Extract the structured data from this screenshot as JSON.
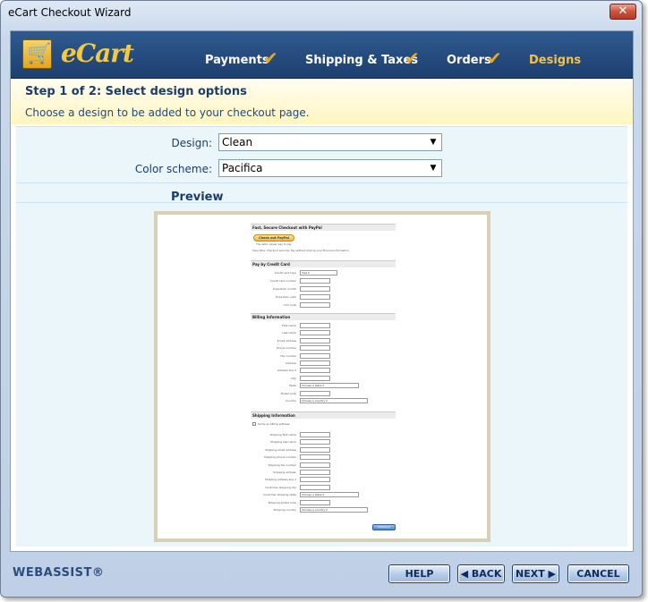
{
  "window": {
    "title": "eCart Checkout Wizard",
    "close_label": "✕"
  },
  "header": {
    "brand": "eCart",
    "steps": [
      {
        "label": "Payments",
        "done": true
      },
      {
        "label": "Shipping & Taxes",
        "done": true
      },
      {
        "label": "Orders",
        "done": true
      },
      {
        "label": "Designs",
        "done": false
      }
    ]
  },
  "step": {
    "title": "Step 1 of 2: Select design options",
    "subtitle": "Choose a design to be added to your checkout page."
  },
  "form": {
    "design_label": "Design:",
    "design_value": "Clean",
    "color_label": "Color scheme:",
    "color_value": "Pacifica"
  },
  "preview": {
    "label": "Preview",
    "sections": {
      "paypal": "Fast, Secure Checkout with PayPal",
      "paypal_btn": "Check out PayPal",
      "paypal_note": "The safer, easier way to pay",
      "paypal_desc": "Save time. Checkout securely. Pay without sharing your financial information.",
      "card": "Pay by Credit Card",
      "card_fields": [
        "Credit card type",
        "Credit card number",
        "Expiration month",
        "Expiration year",
        "CVV code"
      ],
      "card_type_value": "Visa",
      "billing": "Billing Information",
      "billing_fields": [
        "First name",
        "Last name",
        "Email address",
        "Phone number",
        "Fax number",
        "Address",
        "Address line 2",
        "City",
        "State",
        "Postal code",
        "Country"
      ],
      "state_value": "Choose a state",
      "country_value": "Choose a country",
      "shipping": "Shipping Information",
      "same_as_billing": "Same as billing address",
      "shipping_fields": [
        "Shipping first name",
        "Shipping last name",
        "Shipping email address",
        "Shipping phone number",
        "Shipping fax number",
        "Shipping address",
        "Shipping address line 2",
        "Customer shipping city",
        "Customer shipping state",
        "Shipping postal code",
        "Shipping country"
      ],
      "checkout_btn": "Checkout"
    }
  },
  "footer": {
    "logo": "WEBASSIST®",
    "help": "HELP",
    "back": "◀ BACK",
    "next": "NEXT ▶",
    "cancel": "CANCEL"
  }
}
